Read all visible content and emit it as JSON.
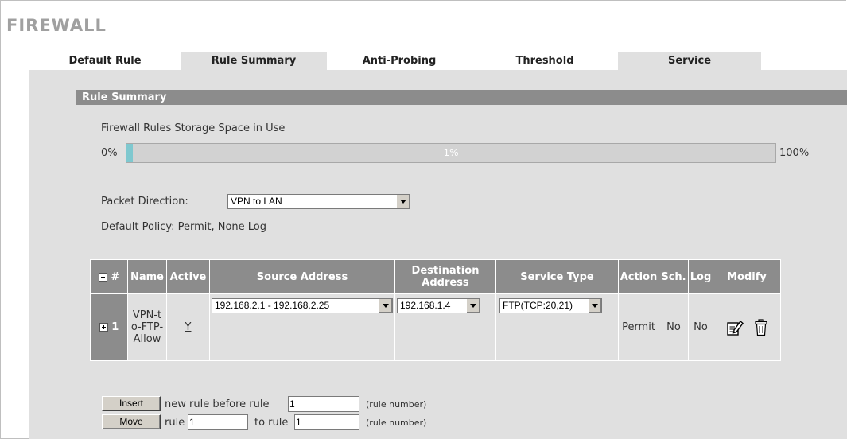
{
  "page": {
    "title": "FIREWALL"
  },
  "tabs": [
    "Default Rule",
    "Rule Summary",
    "Anti-Probing",
    "Threshold",
    "Service"
  ],
  "section": {
    "title": "Rule Summary"
  },
  "storage": {
    "label": "Firewall Rules Storage Space in Use",
    "min_label": "0%",
    "max_label": "100%",
    "value_label": "1%",
    "used_fraction": 0.01
  },
  "direction": {
    "label": "Packet Direction:",
    "value": "VPN to LAN"
  },
  "policy": {
    "text": "Default Policy: Permit, None Log"
  },
  "table": {
    "headers": {
      "num": "#",
      "name": "Name",
      "active": "Active",
      "source": "Source Address",
      "destination": "Destination Address",
      "service": "Service Type",
      "action": "Action",
      "sch": "Sch.",
      "log": "Log",
      "modify": "Modify"
    },
    "rows": [
      {
        "num": "1",
        "name": "VPN-to-FTP-Allow",
        "active": "Y",
        "source": "192.168.2.1 - 192.168.2.25",
        "destination": "192.168.1.4",
        "service": "FTP(TCP:20,21)",
        "action": "Permit",
        "sch": "No",
        "log": "No"
      }
    ]
  },
  "insert": {
    "button": "Insert",
    "text": "new rule before rule",
    "value": "1",
    "hint": "(rule number)"
  },
  "move": {
    "button": "Move",
    "rule_text": "rule",
    "rule_value": "1",
    "to_text": "to rule",
    "to_value": "1",
    "hint": "(rule number)"
  },
  "icons": {
    "expand": "plus-box-icon",
    "edit": "edit-icon",
    "delete": "trash-icon",
    "dropdown": "chevron-down-icon"
  },
  "colors": {
    "header_bg": "#8c8c8c",
    "panel_bg": "#e0e0e0",
    "storage_fill": "#7fc8cf",
    "title": "#a0a0a0"
  }
}
